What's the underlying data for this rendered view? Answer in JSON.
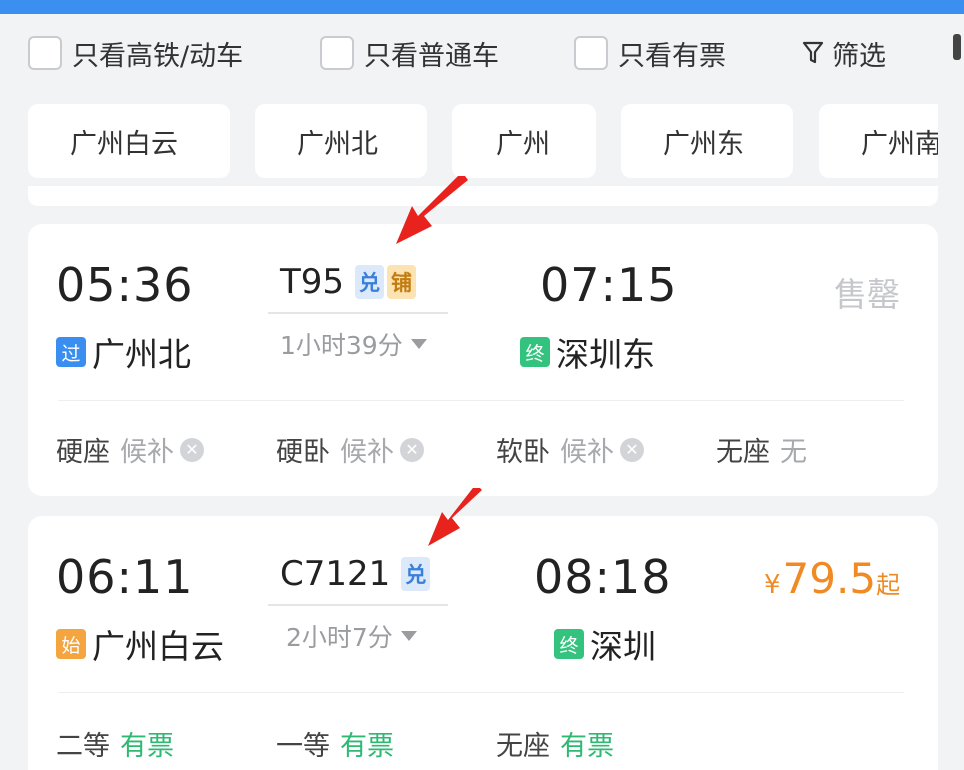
{
  "filters": {
    "hsr_only": "只看高铁/动车",
    "normal_only": "只看普通车",
    "available_only": "只看有票",
    "filter_btn": "筛选"
  },
  "stations": [
    "广州白云",
    "广州北",
    "广州",
    "广州东",
    "广州南"
  ],
  "trains": [
    {
      "depart_time": "05:36",
      "depart_badge": "过",
      "depart_station": "广州北",
      "train_no": "T95",
      "tags": [
        "兑",
        "铺"
      ],
      "duration": "1小时39分",
      "arrive_time": "07:15",
      "arrive_badge": "终",
      "arrive_station": "深圳东",
      "status": "售罄",
      "seats": [
        {
          "name": "硬座",
          "status": "候补"
        },
        {
          "name": "硬卧",
          "status": "候补"
        },
        {
          "name": "软卧",
          "status": "候补"
        },
        {
          "name": "无座",
          "status": "无"
        }
      ]
    },
    {
      "depart_time": "06:11",
      "depart_badge": "始",
      "depart_station": "广州白云",
      "train_no": "C7121",
      "tags": [
        "兑"
      ],
      "duration": "2小时7分",
      "arrive_time": "08:18",
      "arrive_badge": "终",
      "arrive_station": "深圳",
      "price_currency": "¥",
      "price_value": "79.5",
      "price_suffix": "起",
      "seats": [
        {
          "name": "二等",
          "status": "有票"
        },
        {
          "name": "一等",
          "status": "有票"
        },
        {
          "name": "无座",
          "status": "有票"
        }
      ]
    }
  ],
  "icons": {
    "funnel": "funnel-icon",
    "cancel": "close-circle-icon",
    "annotation": "red-arrow-annotation"
  },
  "colors": {
    "accent": "#3b8ff0",
    "price": "#f08a24",
    "available": "#2eb872",
    "annotation_arrow": "#e8231d"
  }
}
